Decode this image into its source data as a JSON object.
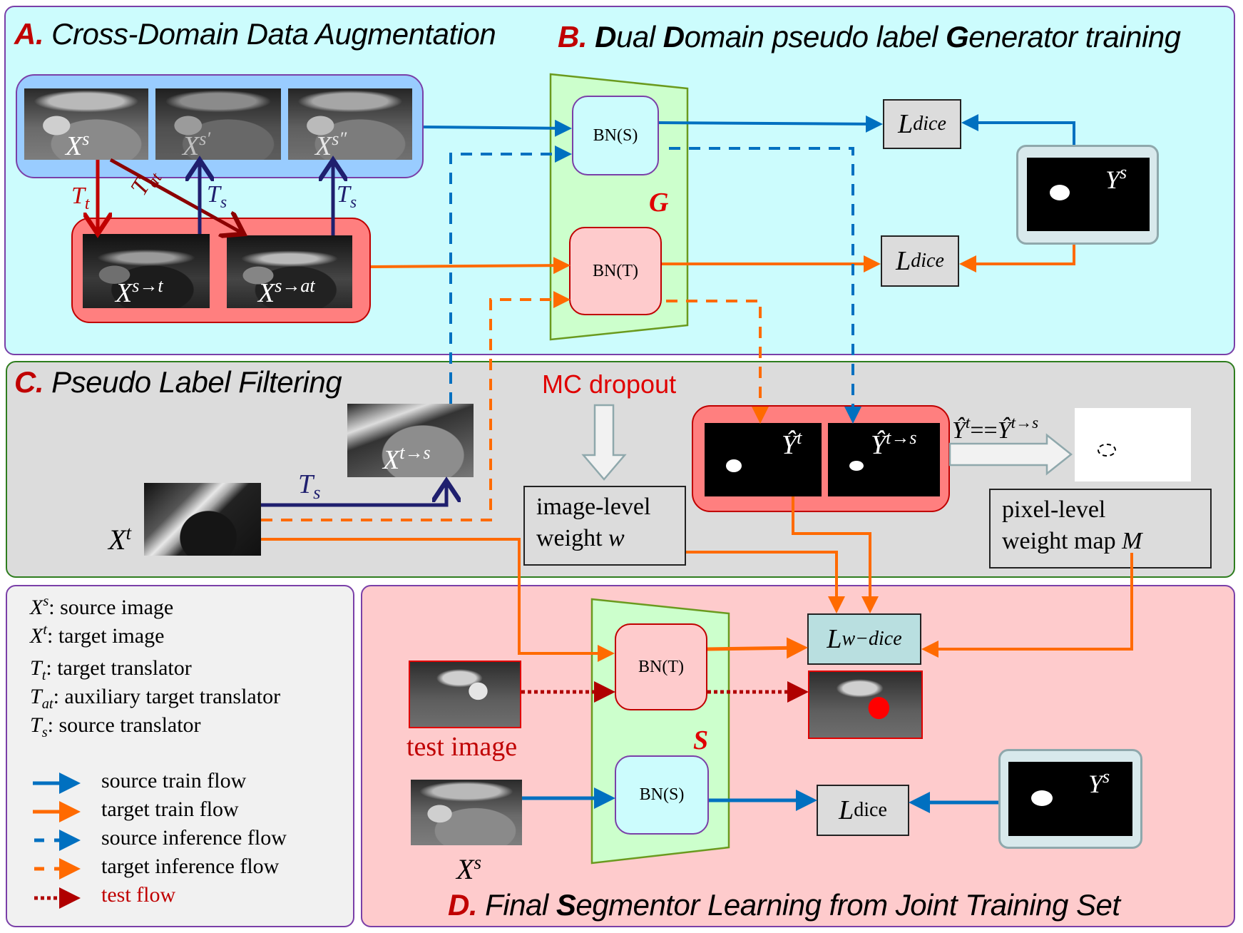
{
  "colors": {
    "source_flow": "#0070c0",
    "target_flow": "#ff6a00",
    "test_flow": "#b00000",
    "translator_target": "#c00000",
    "translator_source": "#1f1f6e",
    "accent_red": "#c00000"
  },
  "sections": {
    "a": {
      "letter": "A.",
      "title": "Cross-Domain Data Augmentation"
    },
    "b": {
      "letter": "B.",
      "title_parts": [
        "D",
        "ual ",
        "D",
        "omain pseudo label ",
        "G",
        "enerator training"
      ]
    },
    "c": {
      "letter": "C.",
      "title": "Pseudo Label Filtering"
    },
    "d": {
      "letter": "D.",
      "title_parts": [
        "Final ",
        "S",
        "egmentor Learning from Joint Training Set"
      ]
    }
  },
  "section_a": {
    "source_images": [
      {
        "base": "X",
        "sup": "s"
      },
      {
        "base": "X",
        "sup": "s′"
      },
      {
        "base": "X",
        "sup": "s″"
      }
    ],
    "target_images": [
      {
        "base": "X",
        "sup": "s→t"
      },
      {
        "base": "X",
        "sup": "s→at"
      }
    ],
    "translators": {
      "tt": {
        "base": "T",
        "sub": "t"
      },
      "tat": {
        "base": "T",
        "sub": "at"
      },
      "ts1": {
        "base": "T",
        "sub": "s"
      },
      "ts2": {
        "base": "T",
        "sub": "s"
      }
    }
  },
  "section_b": {
    "network": "G",
    "bn_source": "BN(S)",
    "bn_target": "BN(T)",
    "loss_top": {
      "base": "L",
      "sub": "dice"
    },
    "loss_bottom": {
      "base": "L",
      "sub": "dice"
    },
    "label": {
      "base": "Y",
      "sup": "s"
    }
  },
  "section_c": {
    "target_image": {
      "base": "X",
      "sup": "t"
    },
    "translated_image": {
      "base": "X",
      "sup": "t→s"
    },
    "translator": {
      "base": "T",
      "sub": "s"
    },
    "mc_dropout": "MC dropout",
    "image_weight": {
      "line1": "image-level",
      "line2": "weight ",
      "var": "w"
    },
    "pred_t": {
      "base": "Ŷ",
      "sup": "t"
    },
    "pred_ts": {
      "base": "Ŷ",
      "sup": "t→s"
    },
    "agreement": {
      "left": "Ŷ",
      "left_sup": "t",
      "op": "==",
      "right": "Ŷ",
      "right_sup": "t→s"
    },
    "pixel_weight": {
      "line1": "pixel-level",
      "line2": "weight map ",
      "var": "M"
    }
  },
  "section_d": {
    "network": "S",
    "bn_target": "BN(T)",
    "bn_source": "BN(S)",
    "loss_weighted": {
      "base": "L",
      "sub": "w−dice"
    },
    "loss_dice": {
      "base": "L",
      "sub": "dice"
    },
    "test_image_label": "test image",
    "source_image": {
      "base": "X",
      "sup": "s"
    },
    "label": {
      "base": "Y",
      "sup": "s"
    }
  },
  "legend": {
    "symbols": [
      {
        "base": "X",
        "sup": "s",
        "sub": "",
        "desc": ": source image"
      },
      {
        "base": "X",
        "sup": "t",
        "sub": "",
        "desc": ": target image"
      },
      {
        "base": "T",
        "sup": "",
        "sub": "t",
        "desc": ": target translator"
      },
      {
        "base": "T",
        "sup": "",
        "sub": "at",
        "desc": ": auxiliary target translator"
      },
      {
        "base": "T",
        "sup": "",
        "sub": "s",
        "desc": ": source translator"
      }
    ],
    "flows": [
      {
        "label": "source train flow",
        "style": "solid",
        "color": "source"
      },
      {
        "label": "target train flow",
        "style": "solid",
        "color": "target"
      },
      {
        "label": "source inference flow",
        "style": "dashed",
        "color": "source"
      },
      {
        "label": "target inference flow",
        "style": "dashed",
        "color": "target"
      },
      {
        "label": "test flow",
        "style": "dotted",
        "color": "test"
      }
    ]
  }
}
